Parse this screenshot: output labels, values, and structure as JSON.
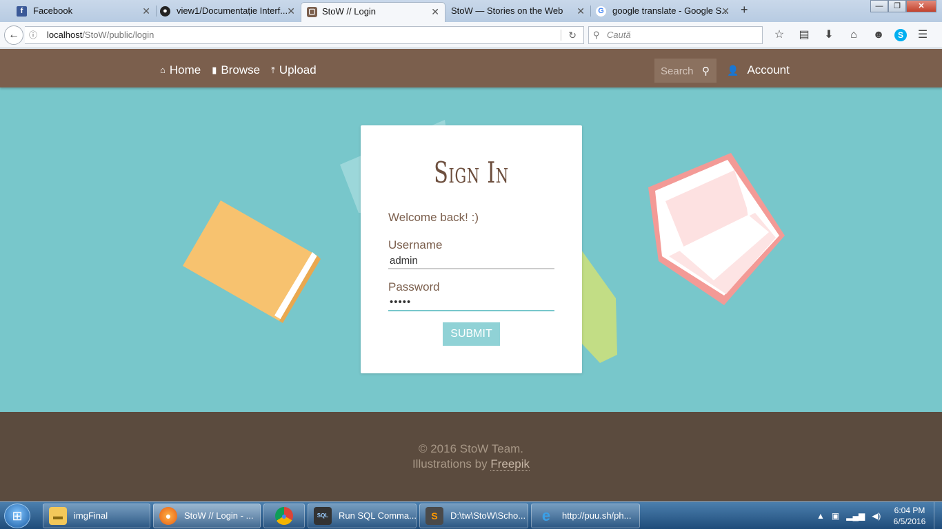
{
  "browser": {
    "tabs": [
      {
        "label": "Facebook",
        "icon": "facebook-icon",
        "active": false
      },
      {
        "label": "view1/Documentație Interf...",
        "icon": "github-icon",
        "active": false
      },
      {
        "label": "StoW // Login",
        "icon": "stow-icon",
        "active": true
      },
      {
        "label": "StoW — Stories on the Web",
        "icon": "",
        "active": false
      },
      {
        "label": "google translate - Google S...",
        "icon": "google-icon",
        "active": false
      }
    ],
    "url_host": "localhost",
    "url_path": "/StoW/public/login",
    "search_placeholder": "Caută"
  },
  "site": {
    "nav": {
      "home": "Home",
      "browse": "Browse",
      "upload": "Upload"
    },
    "search_placeholder": "Search",
    "account": "Account"
  },
  "login": {
    "title": "Sign In",
    "welcome": "Welcome back! :)",
    "username_label": "Username",
    "username_value": "admin",
    "password_label": "Password",
    "password_value": "•••••",
    "submit": "Submit"
  },
  "footer": {
    "copyright": "© 2016 StoW Team.",
    "illustrations_prefix": "Illustrations by ",
    "illustrations_link": "Freepik"
  },
  "taskbar": {
    "items": [
      {
        "label": "imgFinal",
        "icon": "folder-icon"
      },
      {
        "label": "StoW // Login - ...",
        "icon": "firefox-icon"
      },
      {
        "label": "",
        "icon": "chrome-icon"
      },
      {
        "label": "Run SQL Comma...",
        "icon": "sql-icon"
      },
      {
        "label": "D:\\tw\\StoW\\Scho...",
        "icon": "sublime-icon"
      },
      {
        "label": "http://puu.sh/ph...",
        "icon": "ie-icon"
      }
    ],
    "time": "6:04 PM",
    "date": "6/5/2016"
  },
  "colors": {
    "page_bg": "#78c7cb",
    "header_bg": "#7b5f4d",
    "footer_bg": "#5b4b3e",
    "accent": "#90d2d6"
  }
}
